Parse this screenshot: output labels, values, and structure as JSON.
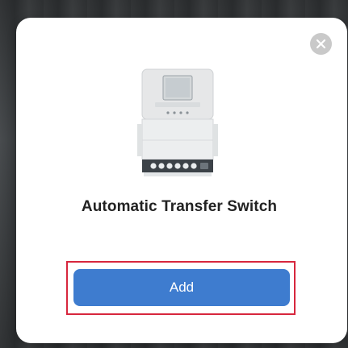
{
  "dialog": {
    "title": "Automatic Transfer Switch",
    "add_label": "Add",
    "close_icon": "close-icon",
    "product_image": "automatic-transfer-switch-device"
  },
  "colors": {
    "primary_button": "#3e7ccf",
    "highlight_border": "#d7263d",
    "close_button_bg": "#c9c9c9"
  }
}
